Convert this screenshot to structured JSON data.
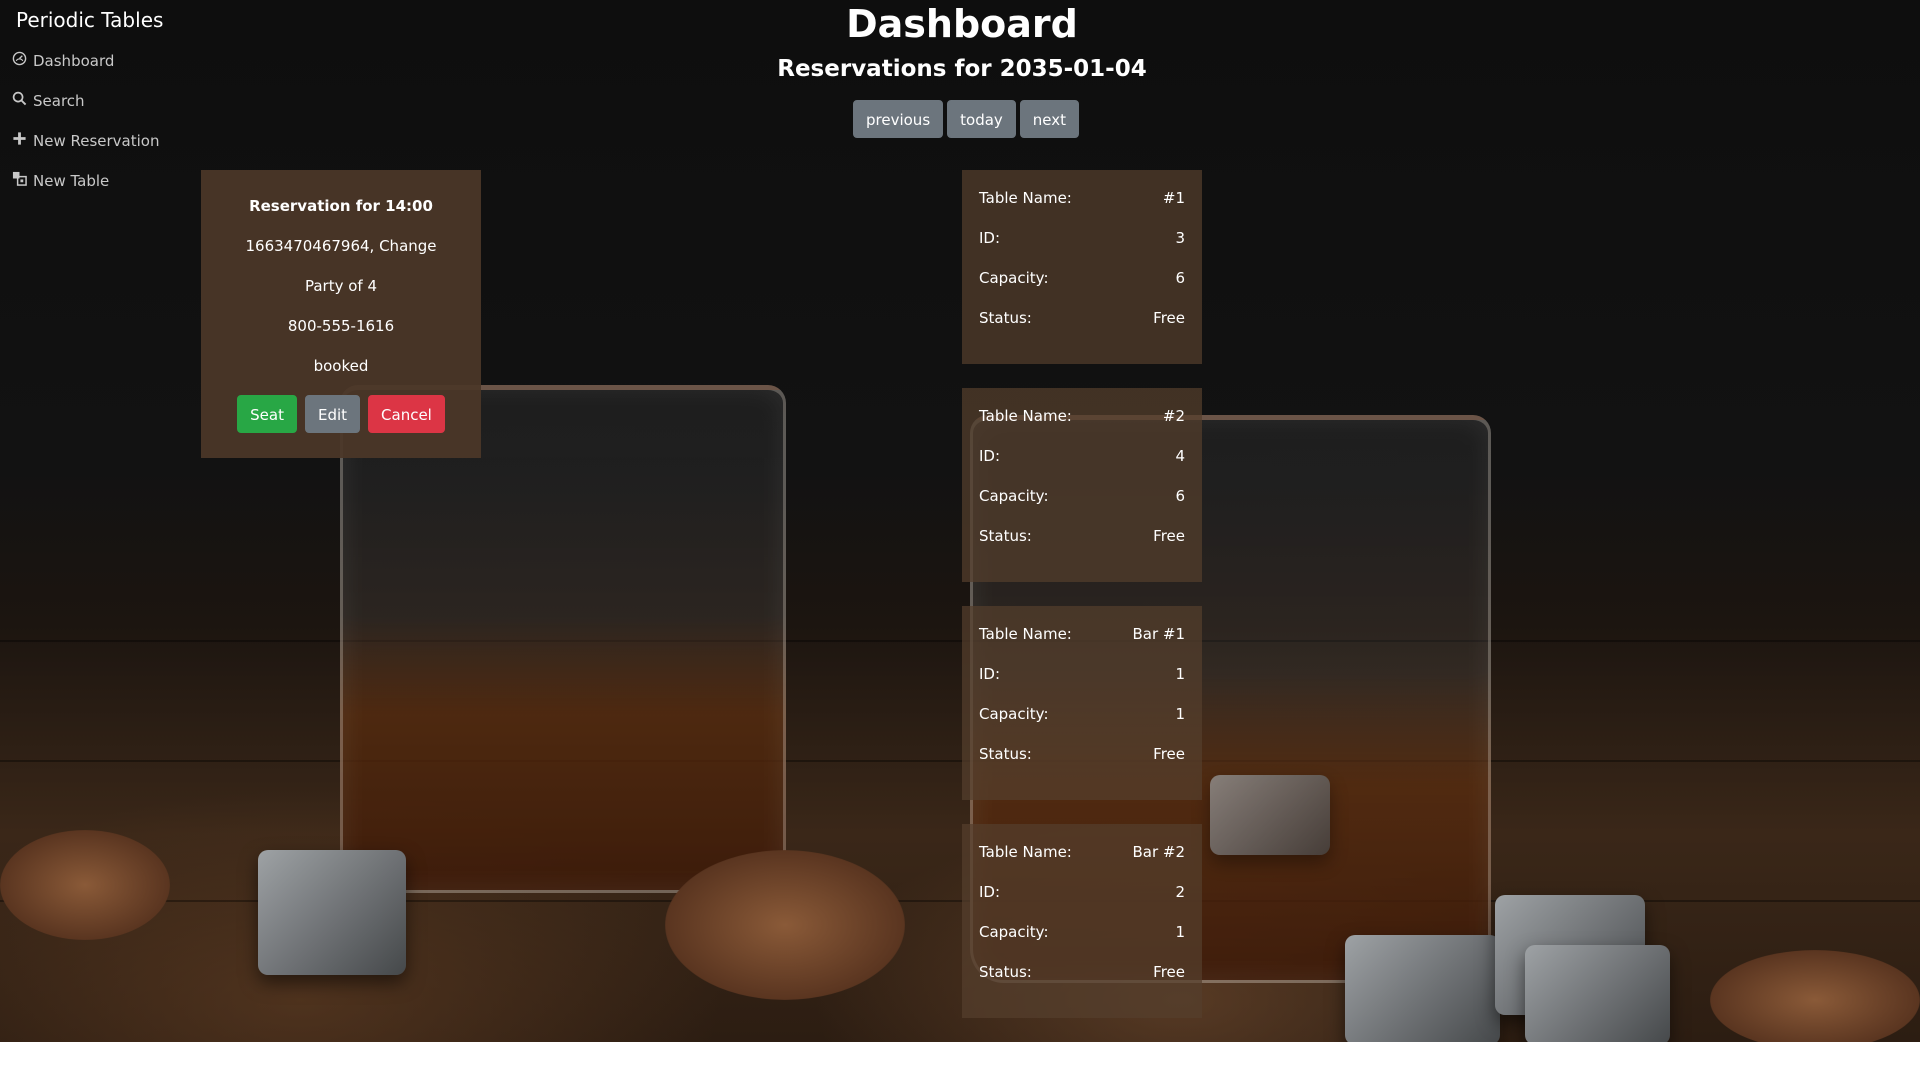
{
  "sidebar": {
    "brand": "Periodic Tables",
    "items": [
      {
        "label": "Dashboard",
        "icon": "dashboard-icon"
      },
      {
        "label": "Search",
        "icon": "search-icon"
      },
      {
        "label": "New Reservation",
        "icon": "plus-icon"
      },
      {
        "label": "New Table",
        "icon": "table-icon"
      }
    ]
  },
  "header": {
    "title": "Dashboard",
    "subtitle": "Reservations for 2035-01-04",
    "buttons": {
      "previous": "previous",
      "today": "today",
      "next": "next"
    }
  },
  "reservation": {
    "title": "Reservation for 14:00",
    "name": "1663470467964, Change",
    "party": "Party of 4",
    "phone": "800-555-1616",
    "status": "booked",
    "actions": {
      "seat": "Seat",
      "edit": "Edit",
      "cancel": "Cancel"
    }
  },
  "tables": {
    "labels": {
      "name": "Table Name:",
      "id": "ID:",
      "capacity": "Capacity:",
      "status": "Status:"
    },
    "items": [
      {
        "name": "#1",
        "id": "3",
        "capacity": "6",
        "status": "Free"
      },
      {
        "name": "#2",
        "id": "4",
        "capacity": "6",
        "status": "Free"
      },
      {
        "name": "Bar #1",
        "id": "1",
        "capacity": "1",
        "status": "Free"
      },
      {
        "name": "Bar #2",
        "id": "2",
        "capacity": "1",
        "status": "Free"
      }
    ]
  },
  "colors": {
    "seat": "#28a745",
    "edit": "#6c757d",
    "cancel": "#dc3545",
    "nav_button": "#6c757d"
  }
}
